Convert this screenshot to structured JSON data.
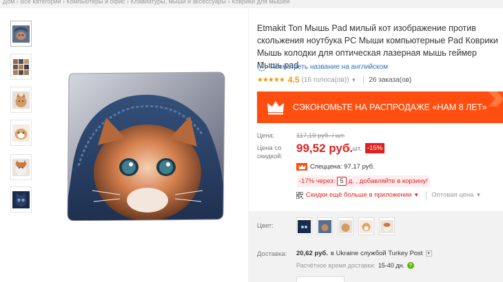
{
  "breadcrumb": "Дом › Все категории › Компьютеры и офис › Клавиатуры, мыши и аксессуары › Коврики для мышей",
  "product": {
    "title": "Etmakit Топ Мышь Pad милый кот изображение против скольжения ноутбука PC Мыши компьютерные Pad Коврики Мышь колодки для оптическая лазерная мышь геймер Мышь pad",
    "translate_link": "Посмотреть название на английском",
    "rating_value": "4.5",
    "votes": "(16 голоса(ов))",
    "orders": "26 заказа(ов)",
    "stars": "★★★★★"
  },
  "promo": {
    "text": "СЭКОНОМЬТЕ НА РАСПРОДАЖЕ «НАМ 8 ЛЕТ»",
    "colors": {
      "banner": "#ff4e0f"
    }
  },
  "price": {
    "price_label": "Цена:",
    "old_price": "117,19 руб. / шт.",
    "discount_label": "Цена со скидкой:",
    "new_price": "99,52 руб.",
    "unit": "/ шт.",
    "discount_badge": "-15%",
    "special_price": "Спеццена: 97,17 руб.",
    "bulk_prefix": "-17% через:",
    "bulk_qty": "5",
    "bulk_suffix": "д. , добавляйте в корзину!",
    "app_discount": "Скидки ещё больше в приложении",
    "wholesale": "Оптовая цена"
  },
  "options": {
    "color_label": "Цвет:",
    "shipping_label": "Доставка:",
    "shipping_cost": "20,62 руб.",
    "shipping_to": "в Ukraine службой Turkey Post",
    "delivery_time_label": "Расчётное время доставки:",
    "delivery_time_value": "15-40 дн."
  },
  "icons": [
    "translate-icon",
    "crown-icon",
    "qr-icon",
    "help-icon",
    "chevron-down-icon"
  ]
}
